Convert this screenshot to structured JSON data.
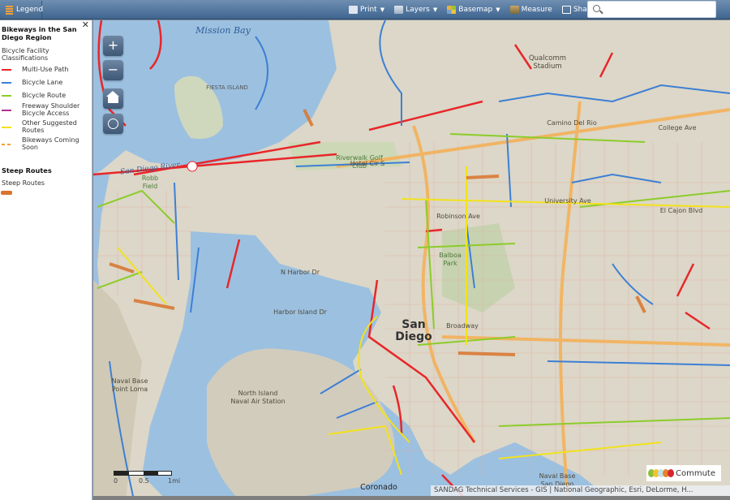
{
  "toolbar": {
    "legend_label": "Legend",
    "tools": [
      {
        "label": "Print",
        "icon": "printer-icon",
        "dropdown": true
      },
      {
        "label": "Layers",
        "icon": "layers-icon",
        "dropdown": true
      },
      {
        "label": "Basemap",
        "icon": "basemap-icon",
        "dropdown": true
      },
      {
        "label": "Measure",
        "icon": "measure-icon",
        "dropdown": false
      },
      {
        "label": "Share",
        "icon": "share-link-icon",
        "dropdown": true
      }
    ],
    "search": {
      "value": "",
      "placeholder": ""
    }
  },
  "legend": {
    "title": "Bikeways in the San Diego Region",
    "subtitle": "Bicycle Facility Classifications",
    "items": [
      {
        "label": "Multi-Use Path",
        "color": "#e8262a",
        "style": "solid"
      },
      {
        "label": "Bicycle Lane",
        "color": "#3d7fd4",
        "style": "solid"
      },
      {
        "label": "Bicycle Route",
        "color": "#8ccc2a",
        "style": "solid"
      },
      {
        "label": "Freeway Shoulder Bicycle Access",
        "color": "#b0318e",
        "style": "solid"
      },
      {
        "label": "Other Suggested Routes",
        "color": "#f2e21c",
        "style": "solid"
      },
      {
        "label": "Bikeways Coming Soon",
        "color": "#f0a030",
        "style": "dashed"
      }
    ],
    "steep_heading": "Steep Routes",
    "steep_item": {
      "label": "Steep Routes",
      "color": "#d9742c"
    }
  },
  "map": {
    "controls": {
      "zoom_in": "+",
      "zoom_out": "−"
    },
    "labels": {
      "mission_bay": "Mission Bay",
      "fiesta_island": "FIESTA ISLAND",
      "san_diego_river": "San Diego River",
      "robb_field": "Robb Field",
      "riverwalk": "Riverwalk Golf Club",
      "qualcomm": "Qualcomm Stadium",
      "san_diego": "San Diego",
      "north_island": "North Island Naval Air Station",
      "naval_base_point_loma": "Naval Base Point Loma",
      "naval_base_san_diego": "Naval Base San Diego",
      "coronado": "Coronado",
      "balboa_park": "Balboa Park",
      "hotel_cir": "Hotel Cir S",
      "n_harbor_dr": "N Harbor Dr",
      "harbor_island_dr": "Harbor Island Dr",
      "broadway": "Broadway",
      "robinson_ave": "Robinson Ave",
      "camino_del_rio": "Camino Del Rio",
      "university_ave": "University Ave",
      "el_cajon_blvd": "El Cajon Blvd",
      "college_ave": "College Ave"
    },
    "scale": {
      "ticks": [
        "0",
        "0.5",
        "1mi"
      ]
    },
    "attribution": "SANDAG Technical Services - GIS | National Geographic, Esri, DeLorme, H...",
    "logo": "Commute"
  }
}
